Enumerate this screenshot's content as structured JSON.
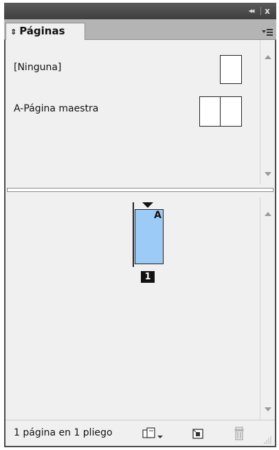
{
  "panel": {
    "tab_label": "Páginas",
    "tab_sort_glyph": "⇕",
    "collapse_glyph": "◂◂",
    "close_glyph": "x"
  },
  "masters": {
    "items": [
      {
        "label": "[Ninguna]",
        "pages": 1
      },
      {
        "label": "A-Página maestra",
        "pages": 2
      }
    ]
  },
  "pages": {
    "items": [
      {
        "number": "1",
        "master_prefix": "A",
        "fill_color": "#9ccbf7"
      }
    ]
  },
  "status": {
    "text": "1 página en 1 pliego"
  },
  "icons": {
    "menu": "panel-menu-icon",
    "new_page_size": "edit-page-size-icon",
    "new_page": "create-new-page-icon",
    "delete": "delete-page-icon",
    "resize": "resize-grip-icon"
  }
}
